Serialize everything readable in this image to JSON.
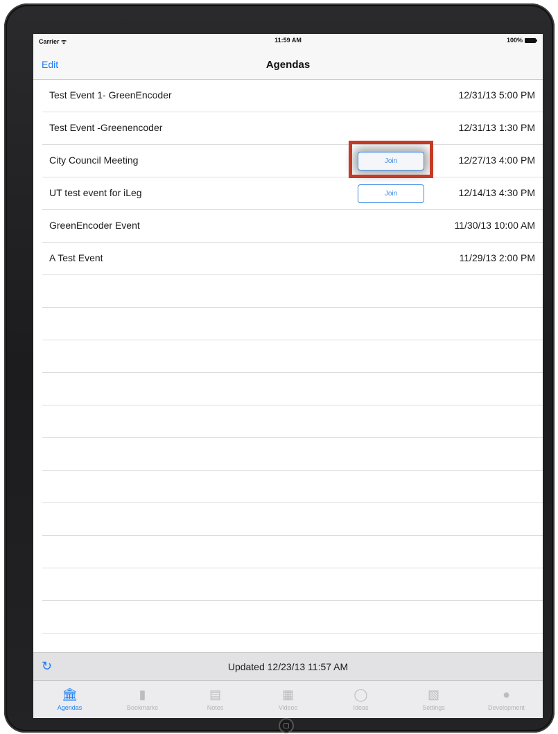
{
  "status_bar": {
    "carrier": "Carrier ᯤ",
    "time": "11:59 AM",
    "battery": "100%"
  },
  "nav_bar": {
    "edit_label": "Edit",
    "title": "Agendas"
  },
  "agendas": [
    {
      "name": "Test Event 1- GreenEncoder",
      "date": "12/31/13 5:00 PM"
    },
    {
      "name": "Test Event -Greenencoder",
      "date": "12/31/13 1:30 PM"
    },
    {
      "name": "City Council Meeting",
      "date": "12/27/13 4:00 PM",
      "join_label": "Join"
    },
    {
      "name": "UT test event for iLeg",
      "date": "12/14/13 4:30 PM",
      "join_label": "Join"
    },
    {
      "name": "GreenEncoder Event",
      "date": "11/30/13 10:00 AM"
    },
    {
      "name": "A Test Event",
      "date": "11/29/13 2:00 PM"
    }
  ],
  "toolbar": {
    "refresh_icon": "refresh-icon",
    "updated_text": "Updated 12/23/13 11:57 AM"
  },
  "tabs": [
    {
      "label": "Agendas",
      "icon": "building-icon",
      "active": true
    },
    {
      "label": "Bookmarks",
      "icon": "bookmark-icon"
    },
    {
      "label": "Notes",
      "icon": "notes-icon"
    },
    {
      "label": "Videos",
      "icon": "film-icon"
    },
    {
      "label": "Ideas",
      "icon": "lightbulb-icon"
    },
    {
      "label": "Settings",
      "icon": "sliders-icon"
    },
    {
      "label": "Development",
      "icon": "speech-bubble-icon"
    }
  ],
  "colors": {
    "accent": "#1a7ef5",
    "callout": "#c53a24"
  }
}
